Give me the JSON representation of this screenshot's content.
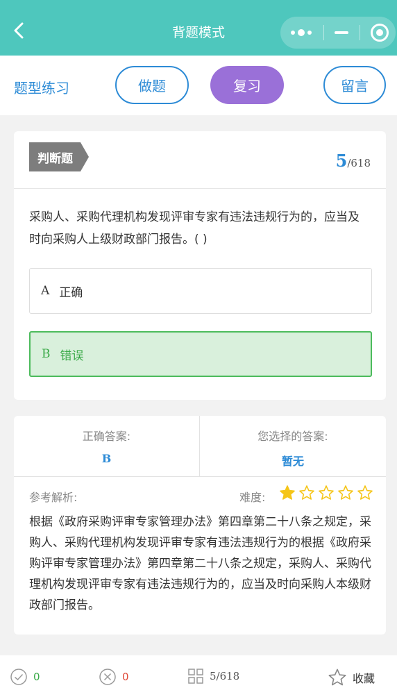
{
  "nav": {
    "title": "背题模式"
  },
  "mode_bar": {
    "label": "题型练习",
    "do_label": "做题",
    "review_label": "复习",
    "message_label": "留言"
  },
  "question": {
    "type": "判断题",
    "current": "5",
    "total": "/618",
    "text": "采购人、采购代理机构发现评审专家有违法违规行为的，应当及时向采购人上级财政部门报告。( )",
    "options": [
      {
        "letter": "A",
        "text": "正确"
      },
      {
        "letter": "B",
        "text": "错误"
      }
    ]
  },
  "answer": {
    "correct_title": "正确答案:",
    "correct_value": "B",
    "chosen_title": "您选择的答案:",
    "chosen_value": "暂无",
    "analysis_label": "参考解析:",
    "difficulty_label": "难度:",
    "difficulty": 1,
    "difficulty_max": 5,
    "analysis_text": "根据《政府采购评审专家管理办法》第四章第二十八条之规定，采购人、采购代理机构发现评审专家有违法违规行为的根据《政府采购评审专家管理办法》第四章第二十八条之规定，采购人、采购代理机构发现评审专家有违法违规行为的，应当及时向采购人本级财政部门报告。"
  },
  "bottom": {
    "correct_count": "0",
    "wrong_count": "0",
    "progress": "5/618",
    "favorite_label": "收藏"
  },
  "colors": {
    "nav_bg": "#4ec7bd",
    "accent_blue": "#2d8bd6",
    "review_purple": "#9a70d8",
    "correct_green": "#3aaa48",
    "wrong_red": "#e04a3a",
    "star_gold": "#f5c518"
  }
}
